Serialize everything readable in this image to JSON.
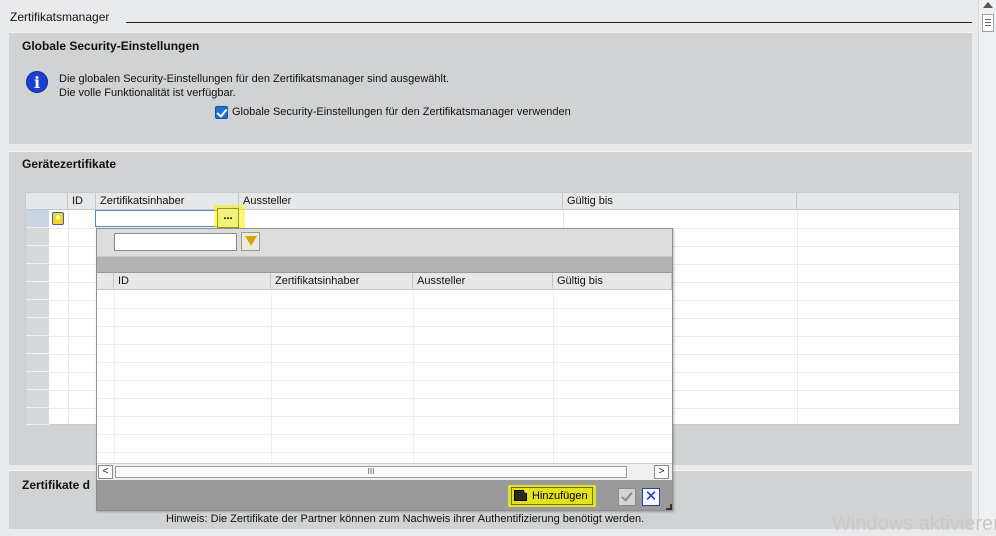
{
  "editor": {
    "title": "Zertifikatsmanager"
  },
  "global_security": {
    "heading": "Globale Security-Einstellungen",
    "info_line1": "Die globalen Security-Einstellungen für den Zertifikatsmanager sind ausgewählt.",
    "info_line2": "Die volle Funktionalität ist verfügbar.",
    "checkbox_label": "Globale Security-Einstellungen für den Zertifikatsmanager verwenden",
    "checkbox_checked": true
  },
  "device_certs": {
    "heading": "Gerätezertifikate",
    "columns": [
      "ID",
      "Zertifikatsinhaber",
      "Aussteller",
      "Gültig bis"
    ],
    "browse_label": "..."
  },
  "picker": {
    "columns": [
      "ID",
      "Zertifikatsinhaber",
      "Aussteller",
      "Gültig bis"
    ],
    "scroll_thumb": "III",
    "scroll_left": "<",
    "scroll_right": ">",
    "add_label": "Hinzufügen",
    "cancel_label": "✕"
  },
  "partner_certs": {
    "heading": "Zertifikate d",
    "hint": "Hinweis:  Die Zertifikate der Partner können zum Nachweis ihrer Authentifizierung benötigt werden."
  },
  "watermark": "Windows aktivieren",
  "colors": {
    "highlight": "#f6f400",
    "panel": "#d0d2d4",
    "info_blue": "#1a3fd2",
    "checkbox_blue": "#1f6fd1"
  }
}
